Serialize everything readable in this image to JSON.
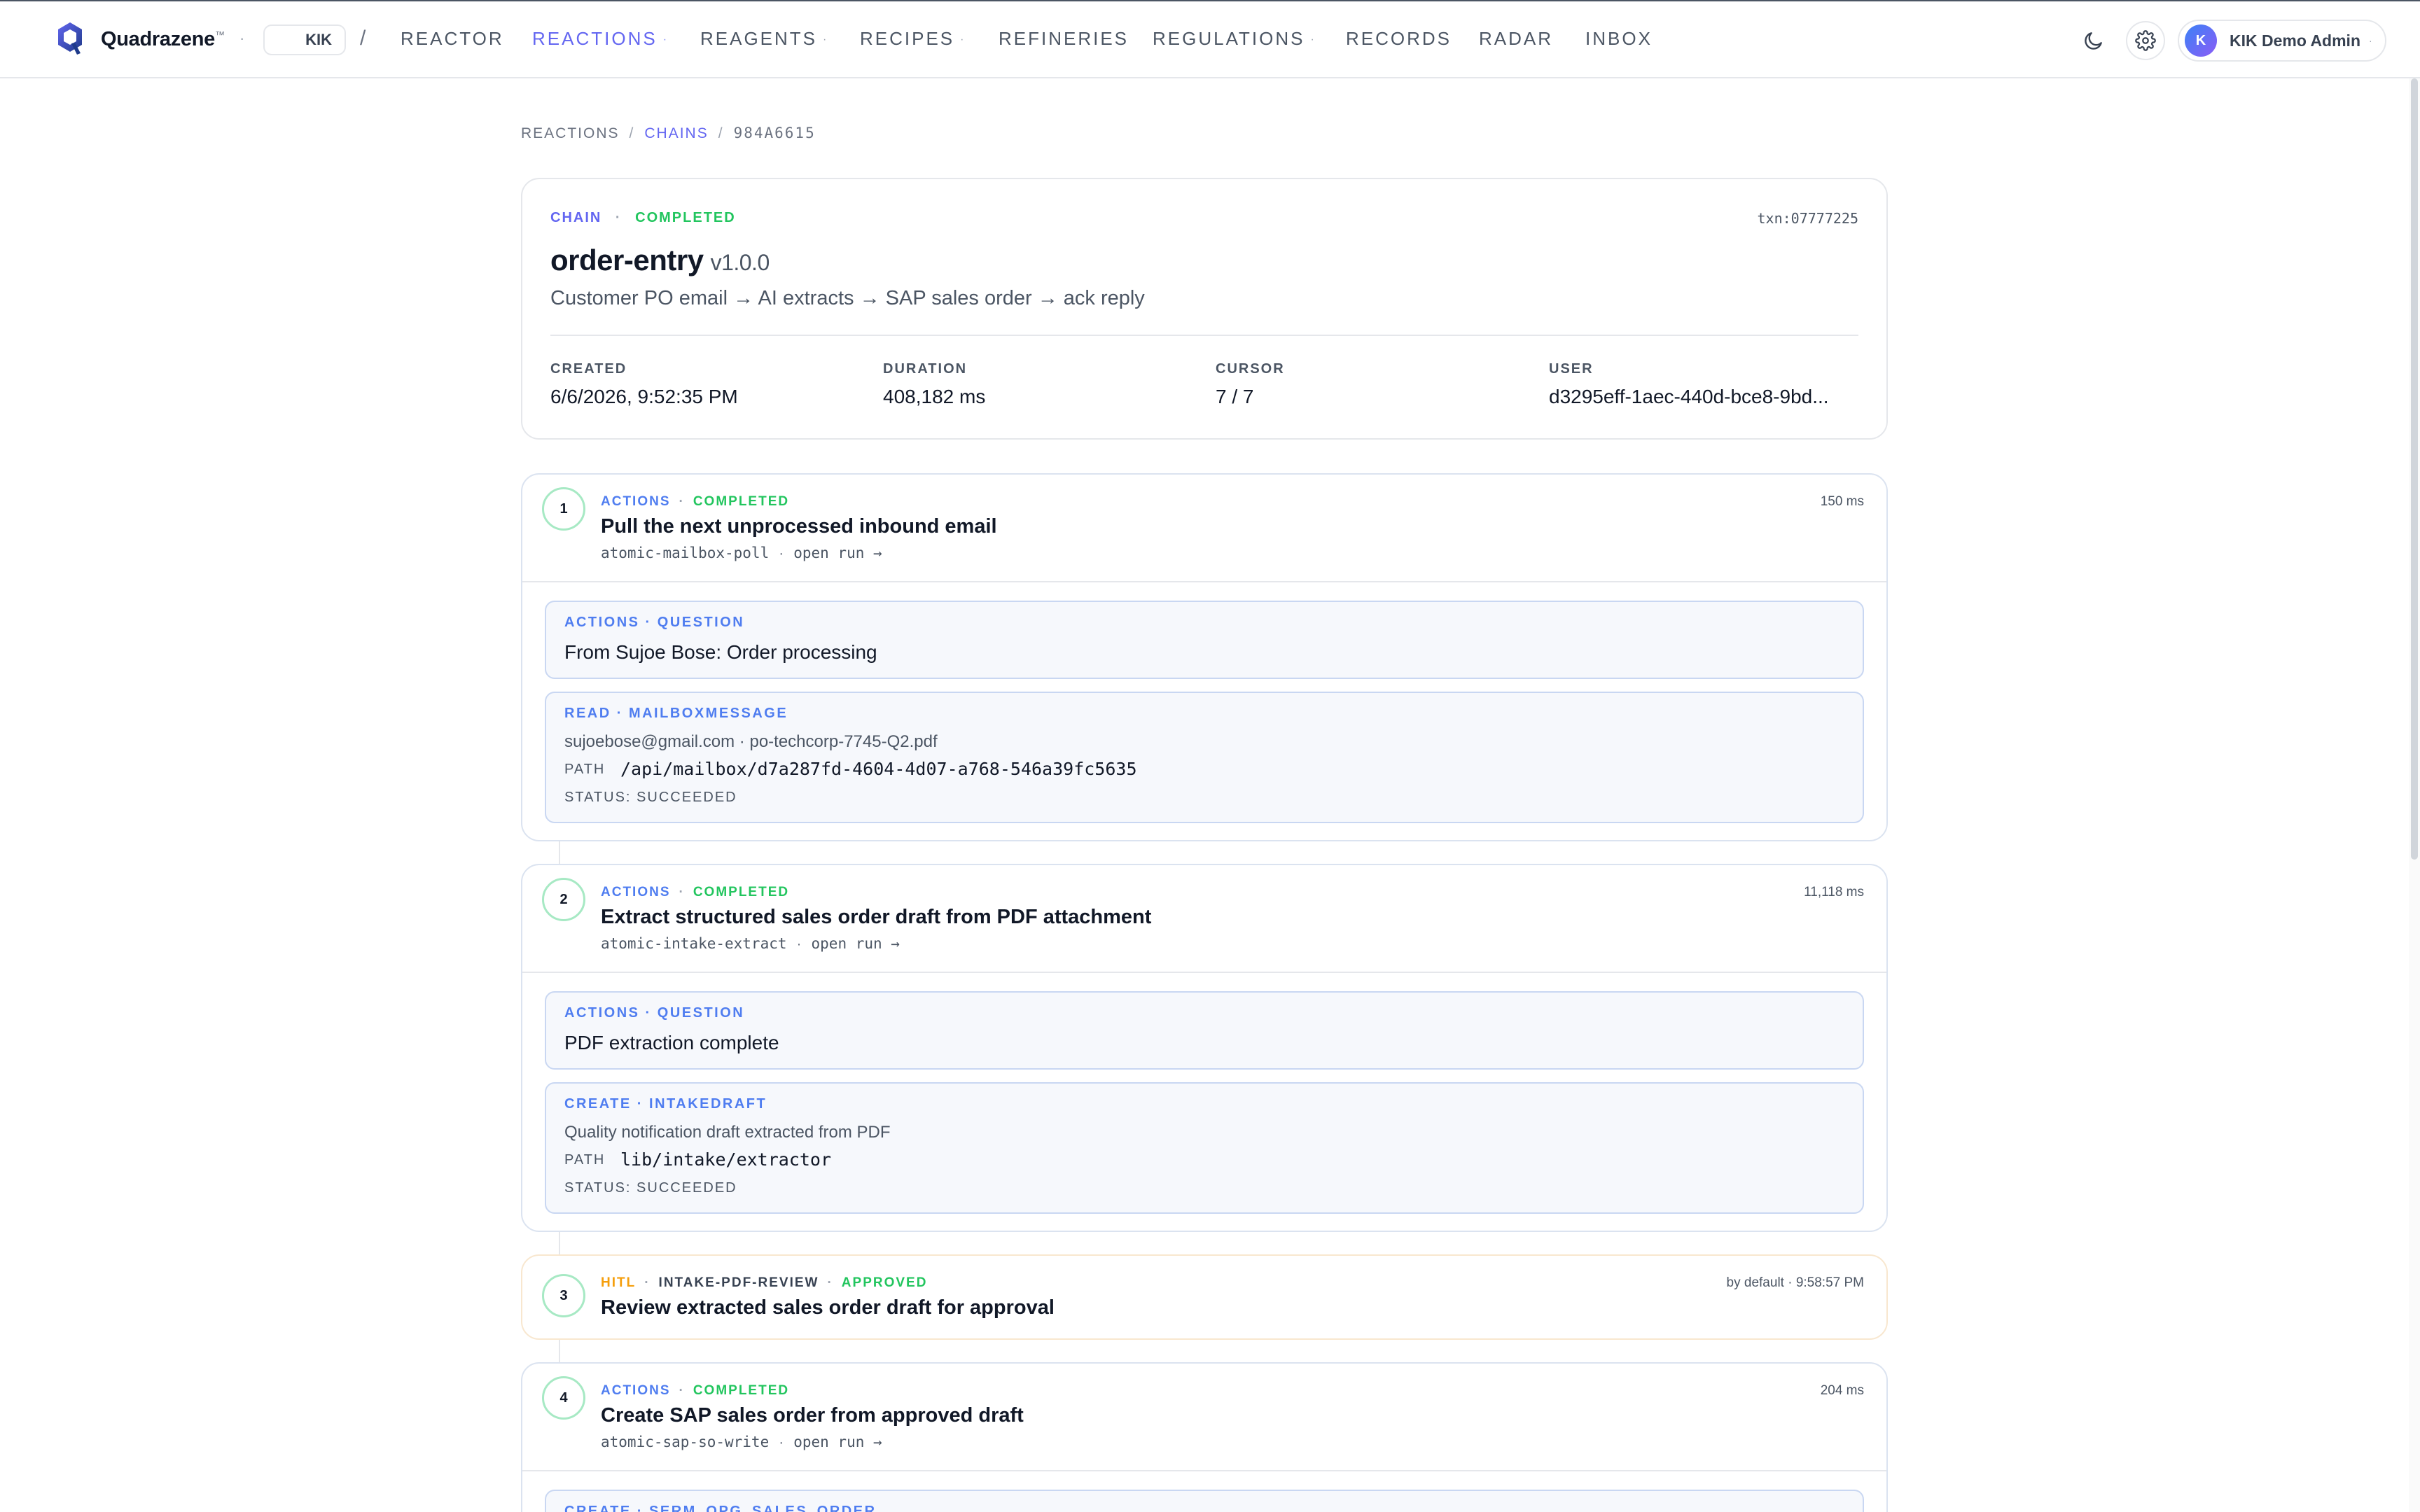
{
  "topnav": {
    "brand": "Quadrazene",
    "trademark": "™",
    "tenant": "KIK",
    "items": [
      {
        "label": "REACTOR",
        "has_menu": false
      },
      {
        "label": "REACTIONS",
        "has_menu": true,
        "active": true
      },
      {
        "label": "REAGENTS",
        "has_menu": true
      },
      {
        "label": "RECIPES",
        "has_menu": true
      },
      {
        "label": "REFINERIES",
        "has_menu": false
      },
      {
        "label": "REGULATIONS",
        "has_menu": true
      },
      {
        "label": "RECORDS",
        "has_menu": false
      },
      {
        "label": "RADAR",
        "has_menu": false
      },
      {
        "label": "INBOX",
        "has_menu": false
      }
    ],
    "user": {
      "initial": "K",
      "name": "KIK Demo Admin"
    }
  },
  "breadcrumb": [
    "REACTIONS",
    "CHAINS",
    "984A6615"
  ],
  "chain": {
    "kind": "CHAIN",
    "status": "COMPLETED",
    "txn": "txn:07777225",
    "name": "order-entry",
    "version": "v1.0.0",
    "description": "Customer PO email → AI extracts → SAP sales order → ack reply",
    "meta": [
      {
        "key": "CREATED",
        "value": "6/6/2026, 9:52:35 PM"
      },
      {
        "key": "DURATION",
        "value": "408,182 ms"
      },
      {
        "key": "CURSOR",
        "value": "7 / 7"
      },
      {
        "key": "USER",
        "value": "d3295eff-1aec-440d-bce8-9bd..."
      }
    ]
  },
  "steps": [
    {
      "num": "1",
      "kind": "ACTIONS",
      "status": "COMPLETED",
      "duration": "150 ms",
      "title": "Pull the next unprocessed inbound email",
      "atomic": "atomic-mailbox-poll",
      "link": "open run →",
      "question": {
        "label": "ACTIONS · QUESTION",
        "text": "From Sujoe Bose: Order processing"
      },
      "op": {
        "label": "READ · MAILBOXMESSAGE",
        "detail": "sujoebose@gmail.com · po-techcorp-7745-Q2.pdf",
        "path_key": "PATH",
        "path": "/api/mailbox/d7a287fd-4604-4d07-a768-546a39fc5635",
        "status": "STATUS: SUCCEEDED"
      }
    },
    {
      "num": "2",
      "kind": "ACTIONS",
      "status": "COMPLETED",
      "duration": "11,118 ms",
      "title": "Extract structured sales order draft from PDF attachment",
      "atomic": "atomic-intake-extract",
      "link": "open run →",
      "question": {
        "label": "ACTIONS · QUESTION",
        "text": "PDF extraction complete"
      },
      "op": {
        "label": "CREATE · INTAKEDRAFT",
        "detail": "Quality notification draft extracted from PDF",
        "path_key": "PATH",
        "path": "lib/intake/extractor",
        "status": "STATUS: SUCCEEDED"
      }
    },
    {
      "num": "3",
      "kind": "HITL",
      "gate": "INTAKE-PDF-REVIEW",
      "status": "APPROVED",
      "approval": "by default · 9:58:57 PM",
      "title": "Review extracted sales order draft for approval"
    },
    {
      "num": "4",
      "kind": "ACTIONS",
      "status": "COMPLETED",
      "duration": "204 ms",
      "title": "Create SAP sales order from approved draft",
      "atomic": "atomic-sap-so-write",
      "link": "open run →",
      "op": {
        "label": "CREATE · SERM_OPG_SALES_ORDER"
      }
    }
  ],
  "colors": {
    "accent": "#6366f1",
    "success": "#22c55e",
    "info": "#4f7df0",
    "hitl": "#f59e0b"
  },
  "icons": [
    "quadrazene-logo-icon",
    "moon-icon",
    "gear-icon",
    "chevron-down-icon"
  ]
}
